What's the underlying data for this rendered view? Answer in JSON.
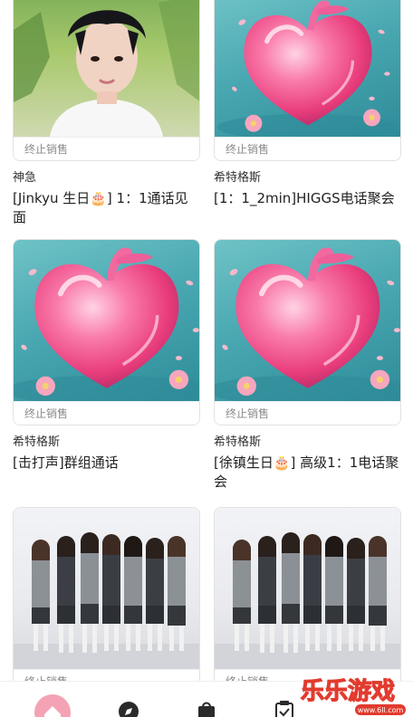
{
  "cards": [
    {
      "status": "终止销售",
      "seller": "神急",
      "title": "[Jinkyu 生日🎂] 1：1通话见面",
      "image": "idol-portrait"
    },
    {
      "status": "终止销售",
      "seller": "希特格斯",
      "title": "[1：1_2min]HIGGS电话聚会",
      "image": "heart-apple"
    },
    {
      "status": "终止销售",
      "seller": "希特格斯",
      "title": "[击打声]群组通话",
      "image": "heart-apple"
    },
    {
      "status": "终止销售",
      "seller": "希特格斯",
      "title": "[徐镇生日🎂] 高级1：1电话聚会",
      "image": "heart-apple"
    },
    {
      "status": "终止销售",
      "seller": "",
      "title": "",
      "image": "group-photo"
    },
    {
      "status": "终止销售",
      "seller": "",
      "title": "",
      "image": "group-photo"
    }
  ],
  "tabbar": {
    "items": [
      {
        "icon": "home-icon",
        "active": true
      },
      {
        "icon": "compass-icon",
        "active": false
      },
      {
        "icon": "shopping-bag-icon",
        "active": false
      },
      {
        "icon": "clipboard-check-icon",
        "active": false
      }
    ]
  },
  "watermark": {
    "text": "乐乐游戏",
    "url": "www.6ll.com"
  },
  "colors": {
    "accent": "#f4a3b4",
    "heart": "#f0508a",
    "teal": "#4aa8b2"
  }
}
